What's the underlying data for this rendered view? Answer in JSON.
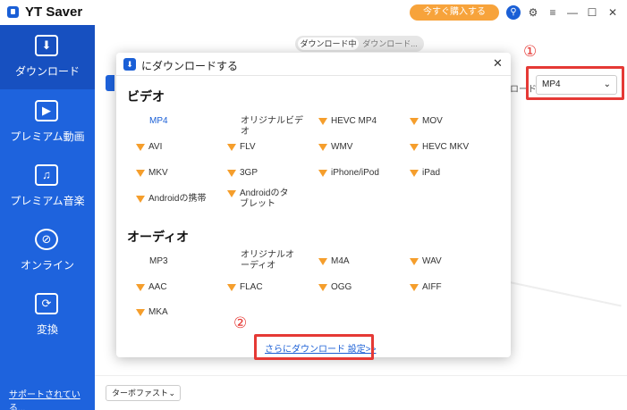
{
  "app": {
    "title": "YT Saver",
    "buy_label": "今すぐ購入する"
  },
  "titlebar_icons": [
    "search-icon",
    "gear-icon",
    "menu-icon",
    "minimize-icon",
    "maximize-icon",
    "close-icon"
  ],
  "sidebar": {
    "items": [
      {
        "label": "ダウンロード",
        "icon": "download-icon",
        "glyph": "⬇",
        "active": true
      },
      {
        "label": "プレミアム動画",
        "icon": "video-play-icon",
        "glyph": "▶",
        "active": false
      },
      {
        "label": "プレミアム音楽",
        "icon": "music-note-icon",
        "glyph": "♫",
        "active": false
      },
      {
        "label": "オンライン",
        "icon": "globe-icon",
        "glyph": "⊘",
        "active": false
      },
      {
        "label": "変換",
        "icon": "convert-icon",
        "glyph": "⟳",
        "active": false
      }
    ],
    "support_link": "サポートされている..."
  },
  "main": {
    "tabs": [
      "ダウンロード中",
      "ダウンロード..."
    ],
    "format_label": "ロード",
    "format_value": "MP4",
    "turbo_value": "ターボファスト"
  },
  "modal": {
    "title": "にダウンロードする",
    "video_section": "ビデオ",
    "video_formats": [
      {
        "label": "MP4",
        "premium": false,
        "selected": true
      },
      {
        "label": "オリジナルビデオ",
        "premium": false,
        "selected": false
      },
      {
        "label": "HEVC MP4",
        "premium": true,
        "selected": false
      },
      {
        "label": "MOV",
        "premium": true,
        "selected": false
      },
      {
        "label": "AVI",
        "premium": true,
        "selected": false
      },
      {
        "label": "FLV",
        "premium": true,
        "selected": false
      },
      {
        "label": "WMV",
        "premium": true,
        "selected": false
      },
      {
        "label": "HEVC MKV",
        "premium": true,
        "selected": false
      },
      {
        "label": "MKV",
        "premium": true,
        "selected": false
      },
      {
        "label": "3GP",
        "premium": true,
        "selected": false
      },
      {
        "label": "iPhone/iPod",
        "premium": true,
        "selected": false
      },
      {
        "label": "iPad",
        "premium": true,
        "selected": false
      },
      {
        "label": "Androidの携帯",
        "premium": true,
        "selected": false
      },
      {
        "label": "Androidのタブレット",
        "premium": true,
        "selected": false
      }
    ],
    "audio_section": "オーディオ",
    "audio_formats": [
      {
        "label": "MP3",
        "premium": false,
        "selected": false
      },
      {
        "label": "オリジナルオーディオ",
        "premium": false,
        "selected": false
      },
      {
        "label": "M4A",
        "premium": true,
        "selected": false
      },
      {
        "label": "WAV",
        "premium": true,
        "selected": false
      },
      {
        "label": "AAC",
        "premium": true,
        "selected": false
      },
      {
        "label": "FLAC",
        "premium": true,
        "selected": false
      },
      {
        "label": "OGG",
        "premium": true,
        "selected": false
      },
      {
        "label": "AIFF",
        "premium": true,
        "selected": false
      },
      {
        "label": "MKA",
        "premium": true,
        "selected": false
      }
    ],
    "more_settings_link": "さらにダウンロード 設定>>"
  },
  "annotations": {
    "marker_1": "①",
    "marker_2": "②",
    "color": "#e53935"
  },
  "colors": {
    "brand_blue": "#1e63dd",
    "buy_orange": "#f7a33b",
    "premium_crown": "#f59e2c",
    "link_blue": "#1a5fd6"
  }
}
